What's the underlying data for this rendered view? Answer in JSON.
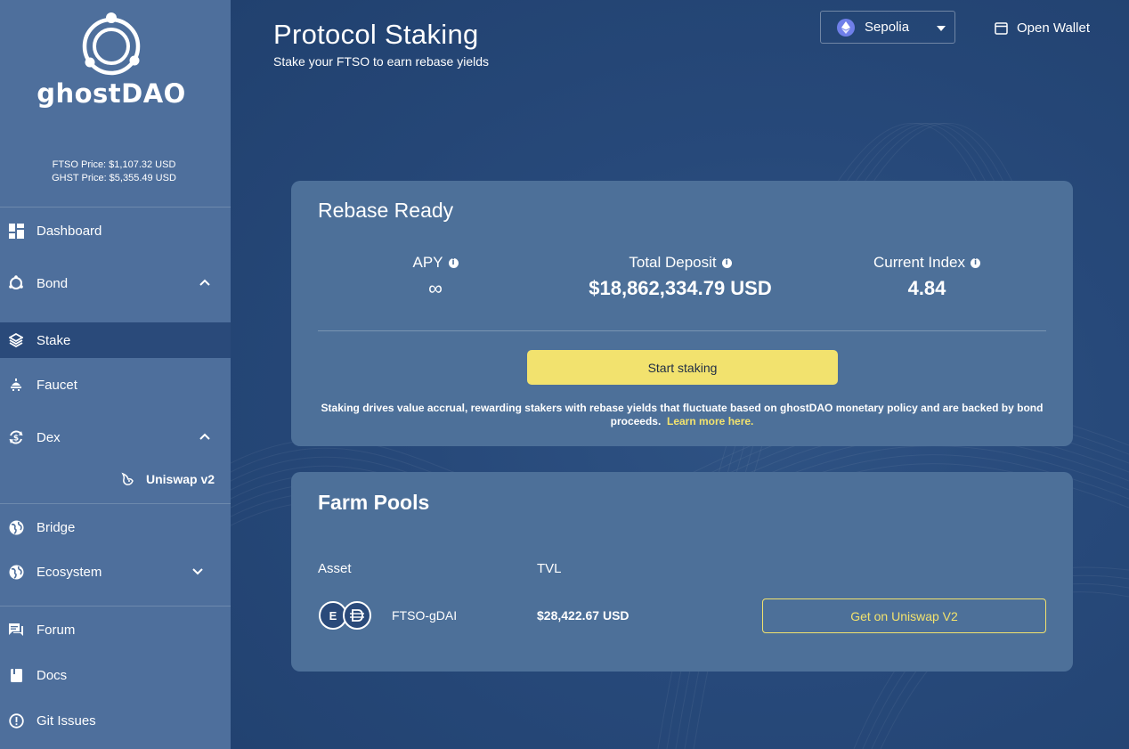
{
  "sidebar": {
    "brand": "ghostDAO",
    "ftso_price": "FTSO Price: $1,107.32 USD",
    "ghst_price": "GHST Price: $5,355.49 USD",
    "items": [
      {
        "label": "Dashboard",
        "icon": "dashboard-icon"
      },
      {
        "label": "Bond",
        "icon": "bond-icon",
        "expanded": true
      },
      {
        "label": "Stake",
        "icon": "stake-layers-icon",
        "active": true
      },
      {
        "label": "Faucet",
        "icon": "faucet-icon"
      },
      {
        "label": "Dex",
        "icon": "dex-swap-icon",
        "expanded": true
      },
      {
        "label": "Uniswap v2",
        "icon": "uniswap-unicorn-icon"
      },
      {
        "label": "Bridge",
        "icon": "globe-icon"
      },
      {
        "label": "Ecosystem",
        "icon": "globe-icon",
        "expanded": false
      },
      {
        "label": "Forum",
        "icon": "forum-chat-icon"
      },
      {
        "label": "Docs",
        "icon": "docs-book-icon"
      },
      {
        "label": "Git Issues",
        "icon": "alert-circle-icon"
      }
    ]
  },
  "header": {
    "title": "Protocol Staking",
    "subtitle": "Stake your FTSO to earn rebase yields",
    "network": "Sepolia",
    "wallet_label": "Open Wallet"
  },
  "rebase_card": {
    "title": "Rebase Ready",
    "stats": [
      {
        "label": "APY",
        "value": "∞"
      },
      {
        "label": "Total Deposit",
        "value": "$18,862,334.79 USD"
      },
      {
        "label": "Current Index",
        "value": "4.84"
      }
    ],
    "button": "Start staking",
    "note": "Staking drives value accrual, rewarding stakers with rebase yields that fluctuate based on ghostDAO monetary policy and are backed by bond proceeds.",
    "link": "Learn more here."
  },
  "farm_card": {
    "title": "Farm Pools",
    "col_asset": "Asset",
    "col_tvl": "TVL",
    "pools": [
      {
        "coin_a": "E",
        "name": "FTSO-gDAI",
        "tvl": "$28,422.67 USD",
        "action": "Get on Uniswap V2"
      }
    ]
  },
  "colors": {
    "sidebar_bg": "#4e6f9c",
    "sidebar_active": "#2a4a7a",
    "main_bg": "#233f6b",
    "card_bg": "#4d7099",
    "accent_yellow": "#f2e26e",
    "network_eth": "#6f7fe9"
  }
}
